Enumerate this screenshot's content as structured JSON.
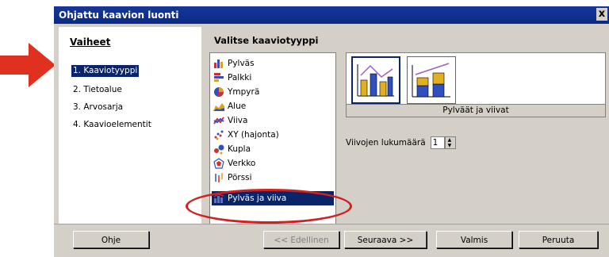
{
  "window": {
    "title": "Ohjattu kaavion luonti",
    "close_glyph": "x"
  },
  "steps": {
    "heading": "Vaiheet",
    "items": [
      {
        "label": "1. Kaaviotyyppi",
        "active": true
      },
      {
        "label": "2. Tietoalue"
      },
      {
        "label": "3. Arvosarja"
      },
      {
        "label": "4. Kaavioelementit"
      }
    ]
  },
  "chart_types": {
    "heading": "Valitse kaaviotyyppi",
    "items": [
      {
        "label": "Pylväs",
        "icon": "bar-chart-icon"
      },
      {
        "label": "Palkki",
        "icon": "horizontal-bar-icon"
      },
      {
        "label": "Ympyrä",
        "icon": "pie-chart-icon"
      },
      {
        "label": "Alue",
        "icon": "area-chart-icon"
      },
      {
        "label": "Viiva",
        "icon": "line-chart-icon"
      },
      {
        "label": "XY (hajonta)",
        "icon": "scatter-icon"
      },
      {
        "label": "Kupla",
        "icon": "bubble-icon"
      },
      {
        "label": "Verkko",
        "icon": "net-chart-icon"
      },
      {
        "label": "Pörssi",
        "icon": "stock-chart-icon"
      },
      {
        "label": "Pylväs ja viiva",
        "icon": "column-line-icon",
        "selected": true
      }
    ]
  },
  "variants": {
    "selected_label": "Pylväät ja viivat"
  },
  "lines": {
    "label": "Viivojen lukumäärä",
    "value": "1"
  },
  "buttons": {
    "help": "Ohje",
    "back": "<< Edellinen",
    "next": "Seuraava >>",
    "finish": "Valmis",
    "cancel": "Peruuta"
  },
  "colors": {
    "title_bar": "#0a2a85",
    "selection": "#0a246a",
    "annotation": "#d02020",
    "dialog_bg": "#d4d0c8"
  }
}
